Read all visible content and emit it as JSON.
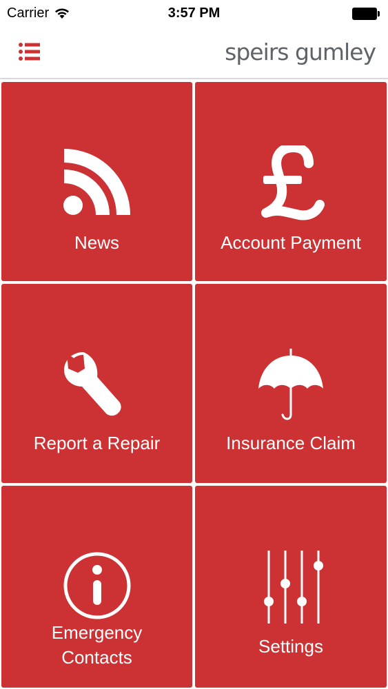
{
  "status_bar": {
    "carrier": "Carrier",
    "time": "3:57 PM"
  },
  "nav": {
    "menu_icon": "list-icon",
    "logo_text": "speirs gumley"
  },
  "tiles": [
    {
      "label": "News",
      "icon": "rss-icon"
    },
    {
      "label": "Account Payment",
      "icon": "pound-icon"
    },
    {
      "label": "Report a Repair",
      "icon": "wrench-icon"
    },
    {
      "label": "Insurance Claim",
      "icon": "umbrella-icon"
    },
    {
      "label_line1": "Emergency",
      "label_line2": "Contacts",
      "icon": "info-icon"
    },
    {
      "label": "Settings",
      "icon": "sliders-icon"
    }
  ],
  "colors": {
    "accent": "#cc3234",
    "tile_text": "#ffffff",
    "logo": "#5e6369"
  }
}
